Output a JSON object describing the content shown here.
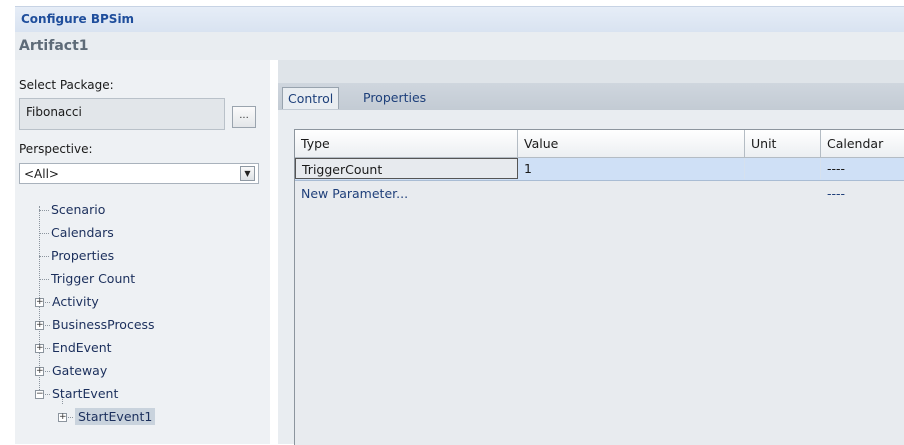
{
  "window": {
    "title": "Configure BPSim",
    "artifact": "Artifact1"
  },
  "left": {
    "select_package_label": "Select Package:",
    "package_value": "Fibonacci",
    "browse_label": "...",
    "perspective_label": "Perspective:",
    "perspective_value": "<All>",
    "tree": [
      {
        "label": "Scenario",
        "expander": "",
        "level": 0
      },
      {
        "label": "Calendars",
        "expander": "",
        "level": 0
      },
      {
        "label": "Properties",
        "expander": "",
        "level": 0
      },
      {
        "label": "Trigger Count",
        "expander": "",
        "level": 0
      },
      {
        "label": "Activity",
        "expander": "+",
        "level": 0
      },
      {
        "label": "BusinessProcess",
        "expander": "+",
        "level": 0
      },
      {
        "label": "EndEvent",
        "expander": "+",
        "level": 0
      },
      {
        "label": "Gateway",
        "expander": "+",
        "level": 0
      },
      {
        "label": "StartEvent",
        "expander": "−",
        "level": 0
      },
      {
        "label": "StartEvent1",
        "expander": "+",
        "level": 1,
        "selected": true
      }
    ]
  },
  "right": {
    "tabs": [
      {
        "label": "Control",
        "active": true
      },
      {
        "label": "Properties",
        "active": false
      }
    ],
    "grid": {
      "columns": [
        "Type",
        "Value",
        "Unit",
        "Calendar"
      ],
      "rows": [
        {
          "type": "TriggerCount",
          "value": "1",
          "unit": "",
          "calendar": "----"
        }
      ],
      "new_row": {
        "label": "New Parameter...",
        "calendar": "----"
      }
    }
  },
  "colors": {
    "title_text": "#1f4e9c",
    "selected_row": "#cfe0f6",
    "tree_text": "#1b2f5c"
  }
}
